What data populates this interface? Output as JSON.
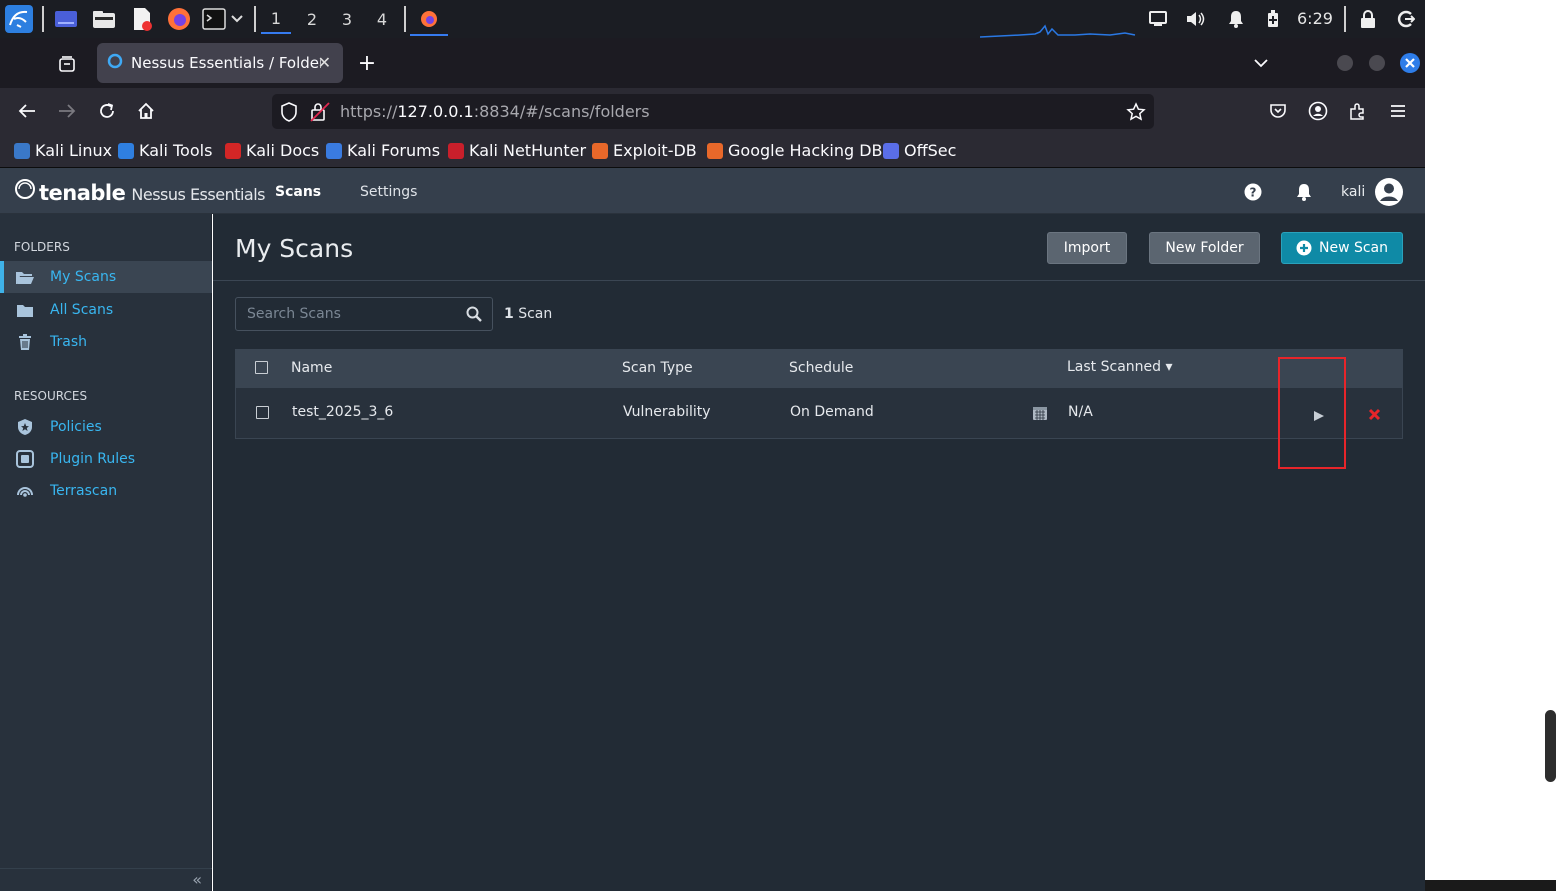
{
  "taskbar": {
    "workspaces": [
      "1",
      "2",
      "3",
      "4"
    ],
    "active_workspace": "1",
    "clock": "6:29"
  },
  "browser": {
    "tab_title": "Nessus Essentials / Folders",
    "url_prefix": "https://",
    "url_host": "127.0.0.1",
    "url_rest": ":8834/#/scans/folders",
    "bookmarks": [
      {
        "label": "Kali Linux",
        "color": "#3a78c8"
      },
      {
        "label": "Kali Tools",
        "color": "#2f7fe0"
      },
      {
        "label": "Kali Docs",
        "color": "#d32626"
      },
      {
        "label": "Kali Forums",
        "color": "#3a7be0"
      },
      {
        "label": "Kali NetHunter",
        "color": "#c91f2b"
      },
      {
        "label": "Exploit-DB",
        "color": "#e8682a"
      },
      {
        "label": "Google Hacking DB",
        "color": "#e8682a"
      },
      {
        "label": "OffSec",
        "color": "#5a6ee8"
      }
    ]
  },
  "nessus": {
    "brand": "tenable",
    "product": "Nessus Essentials",
    "nav": {
      "scans": "Scans",
      "settings": "Settings"
    },
    "user": "kali",
    "sidebar": {
      "folders_heading": "FOLDERS",
      "folders": [
        {
          "label": "My Scans",
          "icon": "folder-open-icon",
          "active": true
        },
        {
          "label": "All Scans",
          "icon": "folder-icon",
          "active": false
        },
        {
          "label": "Trash",
          "icon": "trash-icon",
          "active": false
        }
      ],
      "resources_heading": "RESOURCES",
      "resources": [
        {
          "label": "Policies",
          "icon": "shield-icon"
        },
        {
          "label": "Plugin Rules",
          "icon": "plugin-icon"
        },
        {
          "label": "Terrascan",
          "icon": "terrascan-icon"
        }
      ]
    },
    "page": {
      "title": "My Scans",
      "buttons": {
        "import": "Import",
        "new_folder": "New Folder",
        "new_scan": "New Scan"
      },
      "search_placeholder": "Search Scans",
      "scan_count_num": "1",
      "scan_count_label": "Scan",
      "table": {
        "headers": {
          "name": "Name",
          "type": "Scan Type",
          "schedule": "Schedule",
          "last": "Last Scanned ▾"
        },
        "rows": [
          {
            "name": "test_2025_3_6",
            "type": "Vulnerability",
            "schedule": "On Demand",
            "last": "N/A"
          }
        ]
      }
    },
    "colors": {
      "accent": "#0f8aa6",
      "link": "#39b6f0",
      "delete": "#e8252a",
      "highlight": "#e8252a"
    }
  }
}
